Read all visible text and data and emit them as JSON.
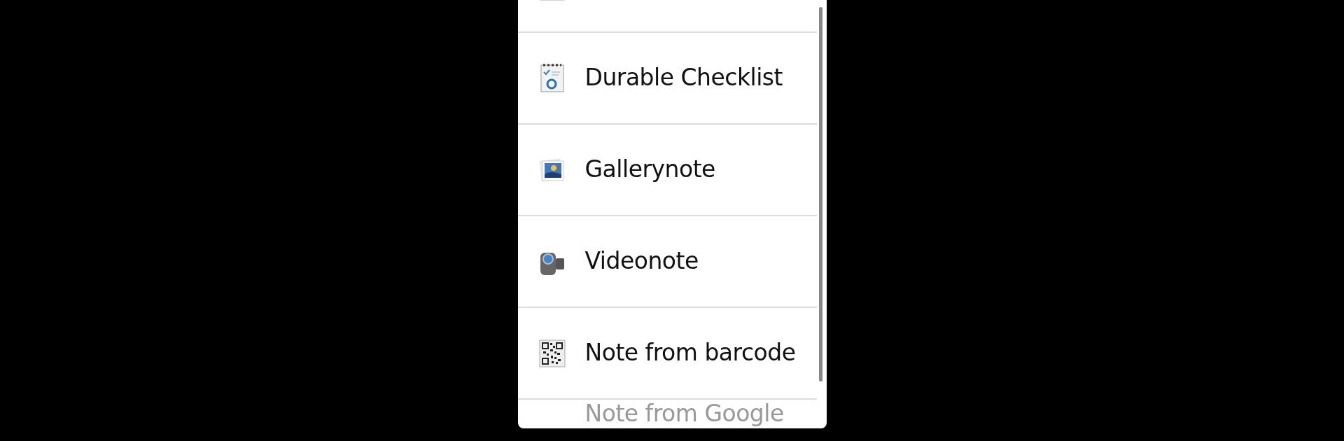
{
  "menu": {
    "items": [
      {
        "kind": "note"
      },
      {
        "kind": "checklist",
        "label": "Durable Checklist"
      },
      {
        "kind": "gallery",
        "label": "Gallerynote"
      },
      {
        "kind": "video",
        "label": "Videonote"
      },
      {
        "kind": "barcode",
        "label": "Note from barcode"
      },
      {
        "kind": "text",
        "label": "Note from Google"
      }
    ]
  }
}
